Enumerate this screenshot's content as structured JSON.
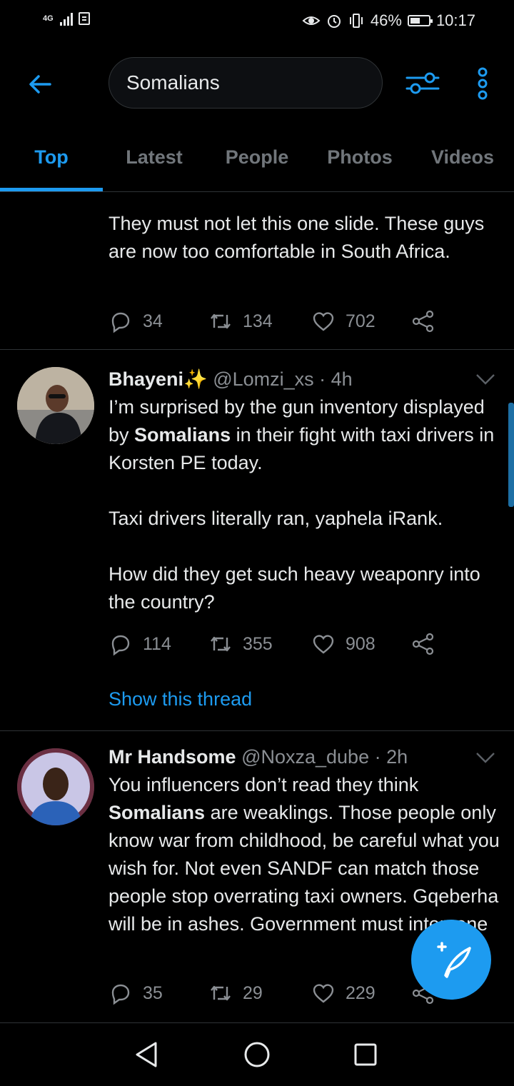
{
  "status_bar": {
    "network": "4G",
    "battery_pct": "46%",
    "time": "10:17"
  },
  "search": {
    "query": "Somalians"
  },
  "tabs": [
    {
      "label": "Top",
      "active": true
    },
    {
      "label": "Latest",
      "active": false
    },
    {
      "label": "People",
      "active": false
    },
    {
      "label": "Photos",
      "active": false
    },
    {
      "label": "Videos",
      "active": false
    }
  ],
  "tweets": [
    {
      "text": "They must not let this one slide. These guys are now too comfortable in South Africa.",
      "replies": "34",
      "retweets": "134",
      "likes": "702"
    },
    {
      "name": "Bhayeni",
      "handle": "@Lomzi_xs",
      "time": "4h",
      "text_before": "I’m surprised by the gun inventory displayed by ",
      "bold": "Somalians",
      "text_after": " in their fight with taxi drivers in Korsten PE today.\n\nTaxi drivers literally ran, yaphela iRank.\n\nHow did they get such heavy weaponry into the country?",
      "replies": "114",
      "retweets": "355",
      "likes": "908",
      "thread_link": "Show this thread"
    },
    {
      "name": "Mr Handsome",
      "handle": "@Noxza_dube",
      "time": "2h",
      "text_before": "You influencers don’t read they think ",
      "bold": "Somalians",
      "text_after": " are weaklings. Those people only know war from childhood, be careful what you wish for. Not even SANDF can match those people stop overrating taxi owners. Gqeberha will be in ashes. Government must intervene",
      "replies": "35",
      "retweets": "29",
      "likes": "229"
    }
  ],
  "colors": {
    "accent": "#1d9bf0",
    "background": "#000000",
    "text": "#e7e9ea",
    "muted": "#71767b"
  }
}
